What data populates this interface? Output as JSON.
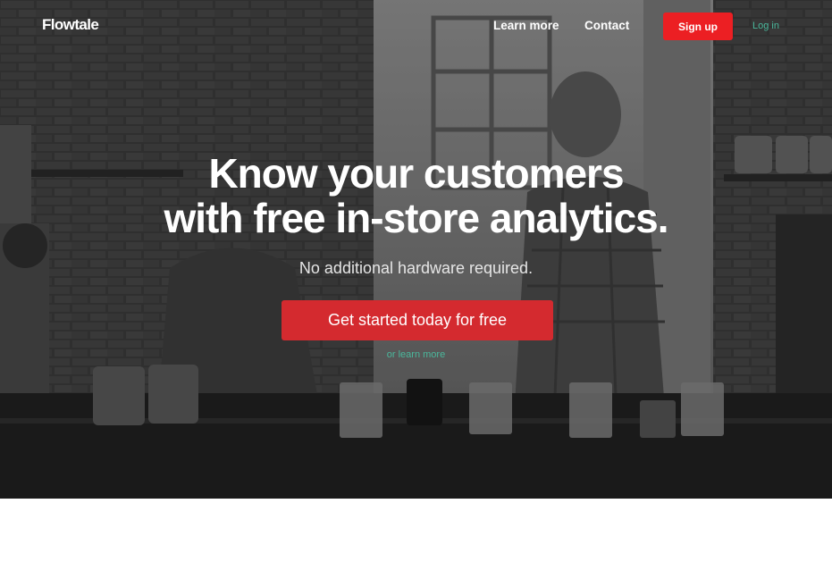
{
  "brand": {
    "name": "Flowtale"
  },
  "nav": {
    "links": [
      {
        "label": "Learn more"
      },
      {
        "label": "Contact"
      }
    ],
    "signup_label": "Sign up",
    "login_label": "Log in"
  },
  "hero": {
    "headline_line1": "Know your customers",
    "headline_line2": "with free in-store analytics.",
    "subhead": "No additional hardware required.",
    "cta_label": "Get started today for free",
    "secondary_link": "or learn more"
  },
  "colors": {
    "accent_red": "#ec1f23",
    "cta_red": "#d42a2f",
    "link_teal": "#4ab89c",
    "hero_bg": "#2f2f2f"
  }
}
